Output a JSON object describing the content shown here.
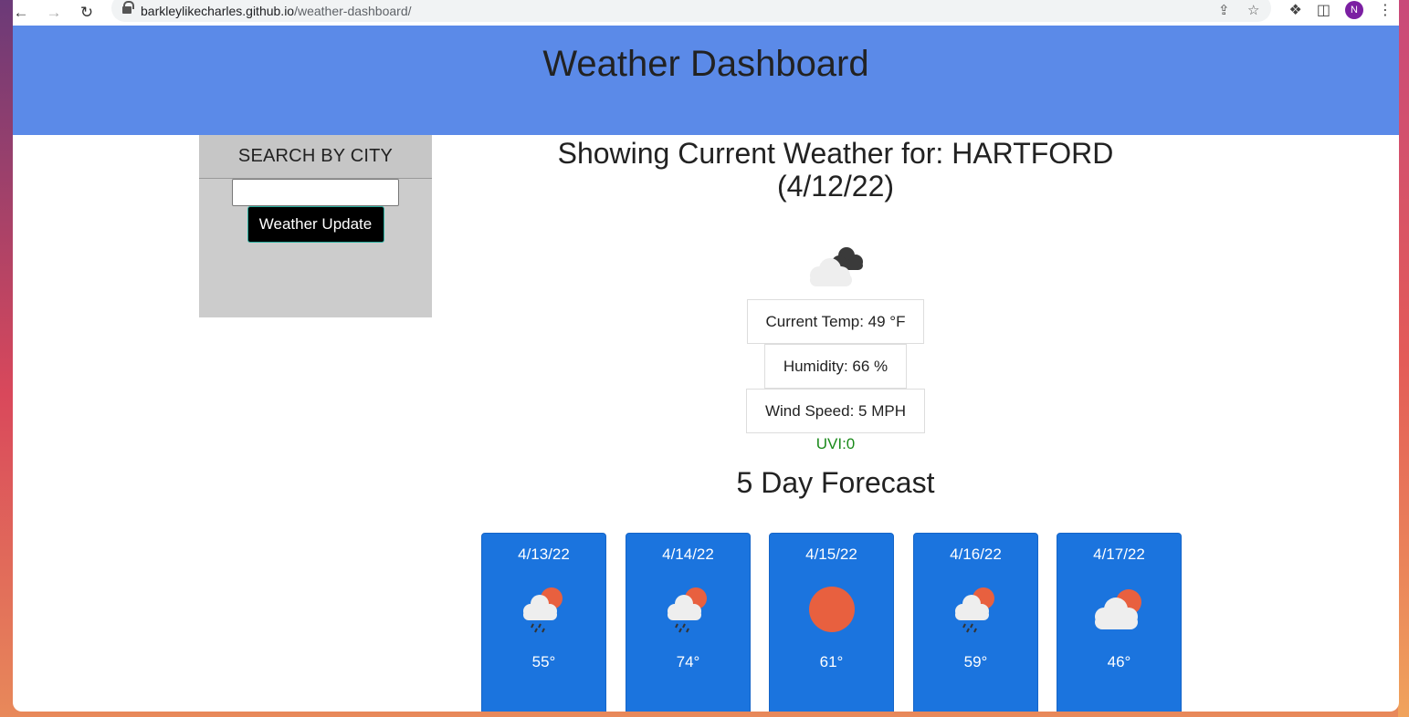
{
  "browser": {
    "url_host": "barkleylikecharles.github.io",
    "url_path": "/weather-dashboard/",
    "profile_initial": "N"
  },
  "header": {
    "title": "Weather Dashboard",
    "bg_color": "#5b8ae8"
  },
  "sidebar": {
    "title": "SEARCH BY CITY",
    "search_value": "",
    "button_label": "Weather Update"
  },
  "current": {
    "title_line1": "Showing Current Weather for: HARTFORD",
    "title_line2": "(4/12/22)",
    "icon": "cloudy-icon",
    "temp": "Current Temp: 49 °F",
    "humidity": "Humidity: 66 %",
    "wind": "Wind Speed: 5 MPH",
    "uvi": "UVI:0",
    "uvi_color": "#1a8a1a"
  },
  "forecast": {
    "title": "5 Day Forecast",
    "card_color": "#1b74de",
    "days": [
      {
        "date": "4/13/22",
        "icon": "rain-sun-icon",
        "temp": "55°"
      },
      {
        "date": "4/14/22",
        "icon": "rain-sun-icon",
        "temp": "74°"
      },
      {
        "date": "4/15/22",
        "icon": "sun-icon",
        "temp": "61°"
      },
      {
        "date": "4/16/22",
        "icon": "rain-sun-icon",
        "temp": "59°"
      },
      {
        "date": "4/17/22",
        "icon": "cloud-sun-icon",
        "temp": "46°"
      }
    ]
  }
}
